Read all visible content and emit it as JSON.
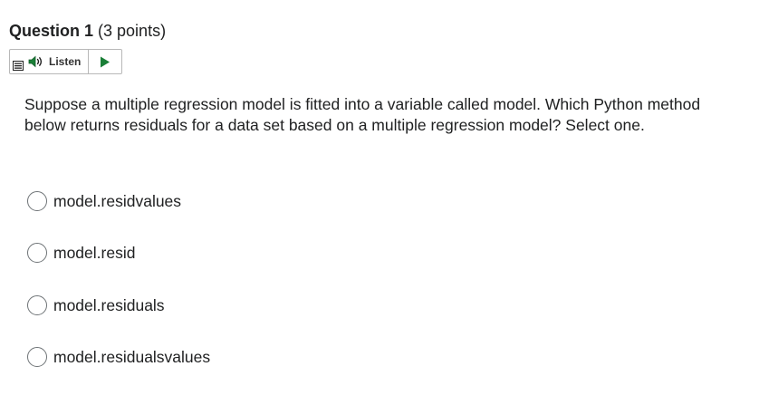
{
  "question": {
    "title": "Question 1",
    "points": "(3 points)",
    "text": "Suppose a multiple regression model is fitted into a variable called model. Which Python method below returns residuals for a data set based on a multiple regression model? Select one."
  },
  "listen": {
    "label": "Listen",
    "accent_color": "#1a7f37"
  },
  "options": [
    {
      "label": "model.residvalues",
      "selected": false
    },
    {
      "label": "model.resid",
      "selected": false
    },
    {
      "label": "model.residuals",
      "selected": false
    },
    {
      "label": "model.residualsvalues",
      "selected": false
    }
  ]
}
